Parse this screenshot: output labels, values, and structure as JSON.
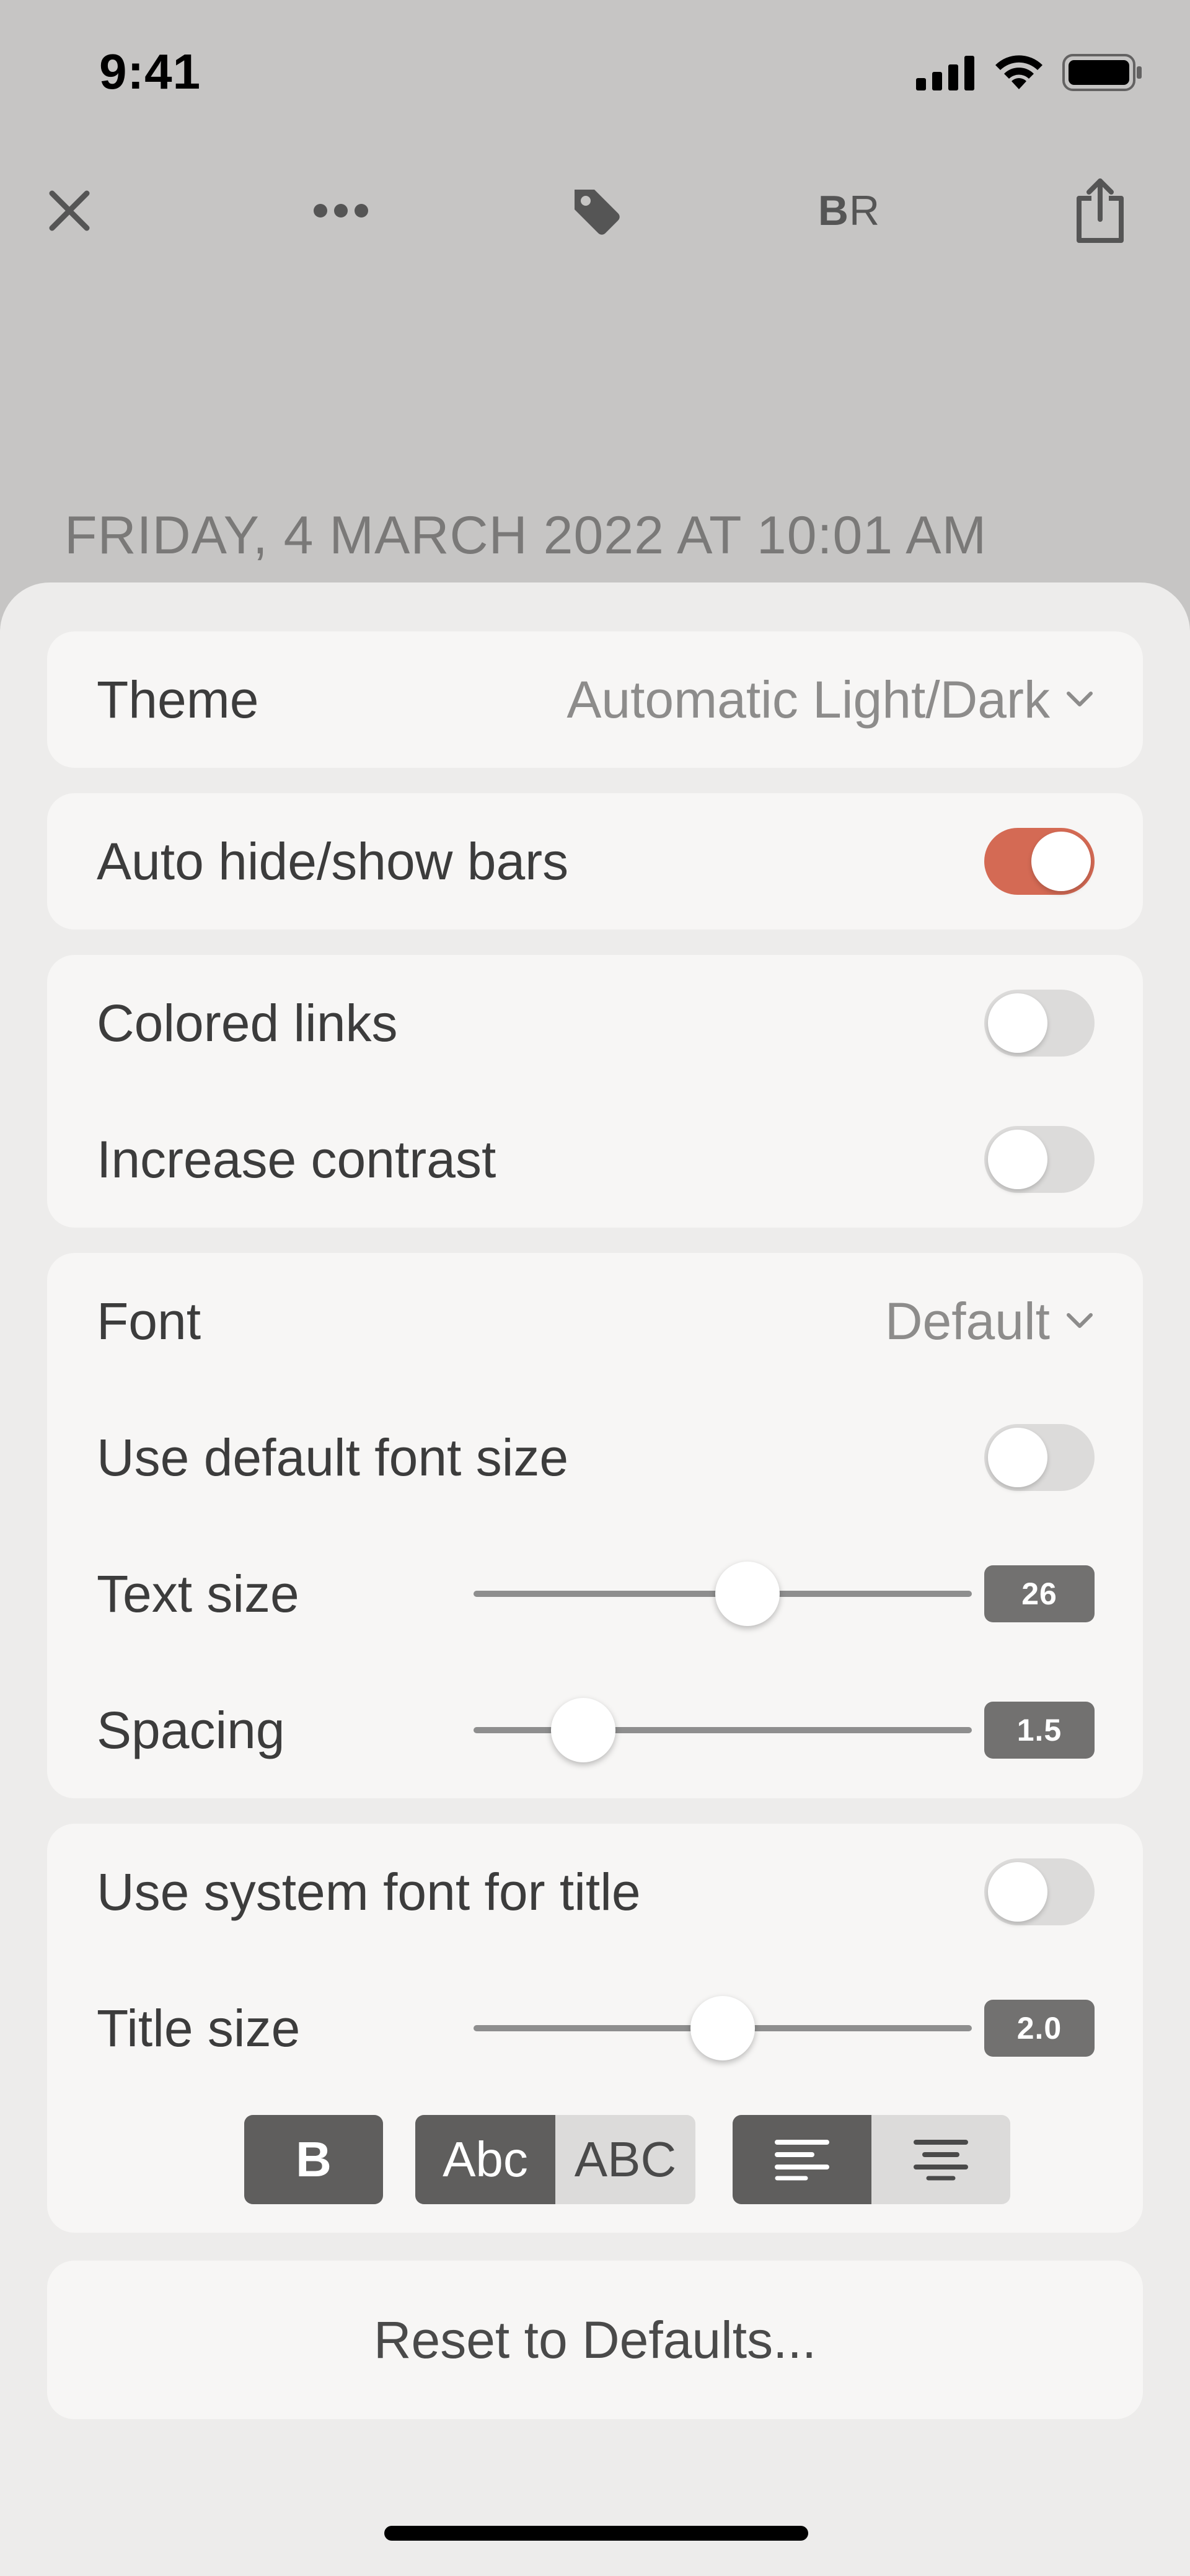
{
  "status_bar": {
    "time": "9:41"
  },
  "toolbar": {
    "close_icon": "close-icon",
    "more_icon": "ellipsis-icon",
    "tag_icon": "tag-icon",
    "reader_bold": "B",
    "reader_regular": "R",
    "share_icon": "share-icon"
  },
  "article": {
    "date": "FRIDAY, 4 MARCH 2022 AT 10:01 AM"
  },
  "settings": {
    "theme": {
      "label": "Theme",
      "value": "Automatic Light/Dark"
    },
    "auto_hide": {
      "label": "Auto hide/show bars",
      "on": true
    },
    "colored_links": {
      "label": "Colored links",
      "on": false
    },
    "increase_contrast": {
      "label": "Increase contrast",
      "on": false
    },
    "font": {
      "label": "Font",
      "value": "Default"
    },
    "default_font_size": {
      "label": "Use default font size",
      "on": false
    },
    "text_size": {
      "label": "Text size",
      "value": "26",
      "level": 0.55
    },
    "spacing": {
      "label": "Spacing",
      "value": "1.5",
      "level": 0.22
    },
    "system_font_title": {
      "label": "Use system font for title",
      "on": false
    },
    "title_size": {
      "label": "Title size",
      "value": "2.0",
      "level": 0.5
    },
    "style_buttons": {
      "bold": "B",
      "title_case": "Abc",
      "upper_case": "ABC",
      "align_left_icon": "align-left-icon",
      "align_center_icon": "align-center-icon"
    },
    "reset_label": "Reset to Defaults..."
  },
  "colors": {
    "accent": "#d46a54",
    "toggle_off": "#dcdbda",
    "card": "#f7f6f5",
    "sheet": "#edeceb"
  }
}
